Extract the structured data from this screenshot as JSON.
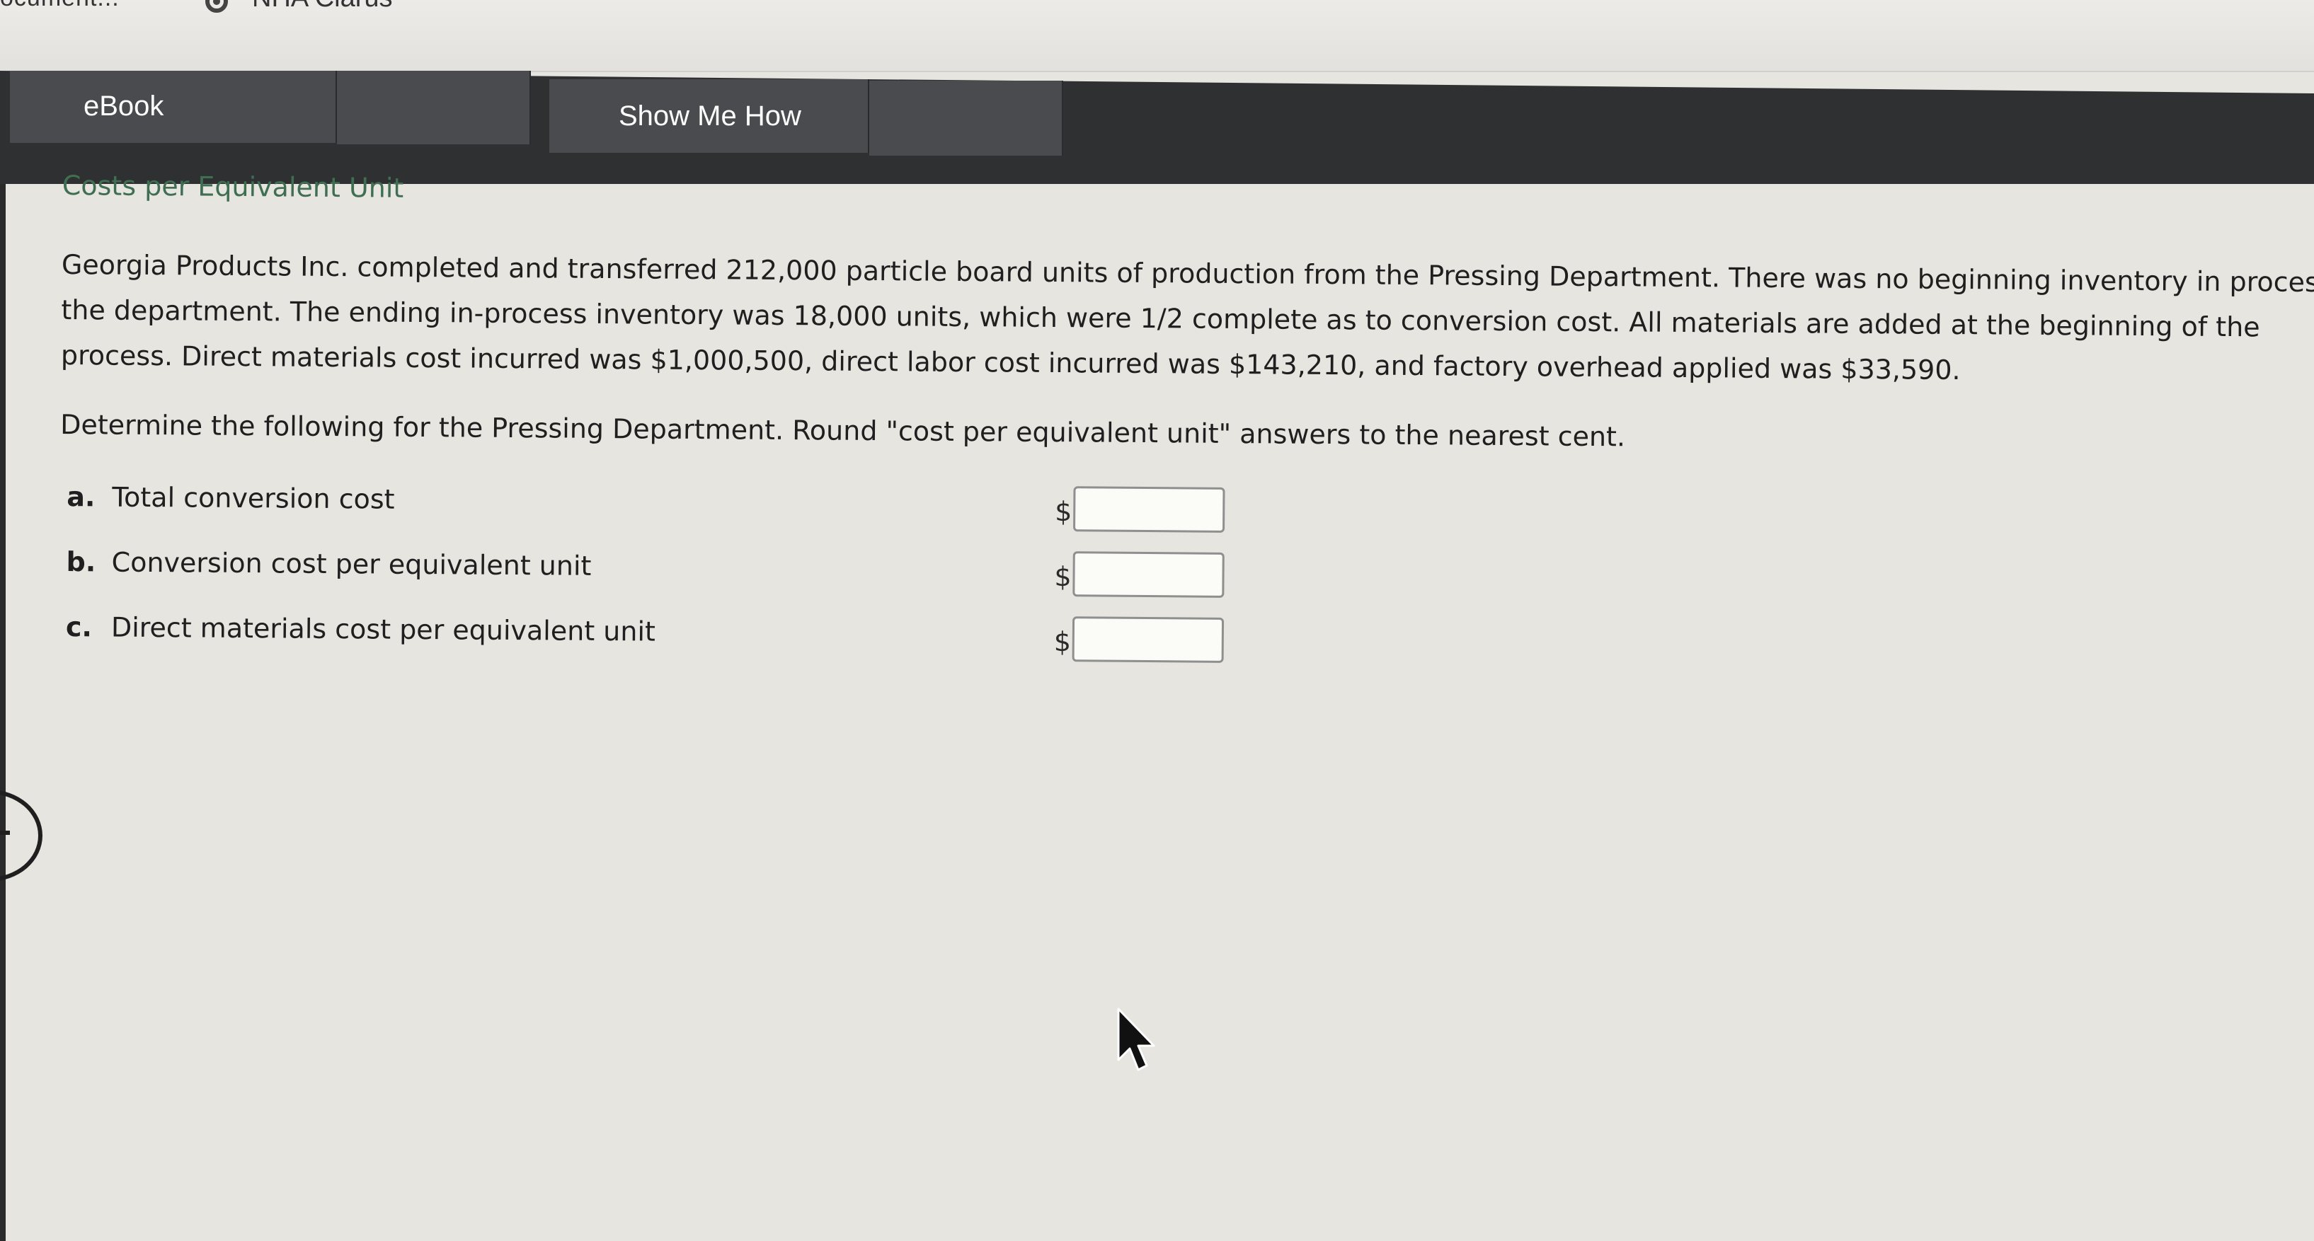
{
  "browser": {
    "doc_crumb": "ocument...",
    "app_name": "NHA Clarus"
  },
  "toolbar": {
    "ebook_label": "eBook",
    "show_me_how_label": "Show Me How"
  },
  "problem": {
    "title": "Costs per Equivalent Unit",
    "paragraph_lines": [
      "Georgia Products Inc. completed and transferred 212,000 particle board units of production from the Pressing Department. There was no beginning inventory in process i",
      "the department. The ending in-process inventory was 18,000 units, which were 1/2 complete as to conversion cost. All materials are added at the beginning of the",
      "process. Direct materials cost incurred was $1,000,500, direct labor cost incurred was $143,210, and factory overhead applied was $33,590."
    ],
    "instructions": "Determine the following for the Pressing Department. Round \"cost per equivalent unit\" answers to the nearest cent."
  },
  "questions": [
    {
      "letter": "a.",
      "label": "Total conversion cost",
      "currency": "$",
      "value": ""
    },
    {
      "letter": "b.",
      "label": "Conversion cost per equivalent unit",
      "currency": "$",
      "value": ""
    },
    {
      "letter": "c.",
      "label": "Direct materials cost per equivalent unit",
      "currency": "$",
      "value": ""
    }
  ]
}
